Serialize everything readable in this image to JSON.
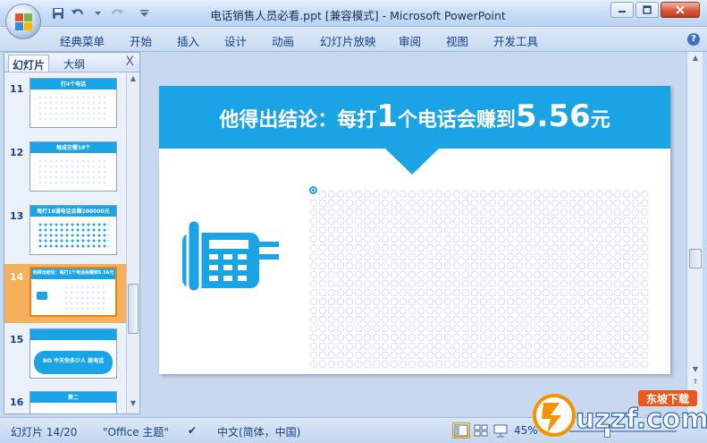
{
  "window": {
    "title": "电话销售人员必看.ppt [兼容模式] - Microsoft PowerPoint",
    "controls": [
      "minimize",
      "restore",
      "close"
    ]
  },
  "quick_access": [
    "save-icon",
    "undo-icon",
    "redo-icon",
    "customize-icon"
  ],
  "ribbon": {
    "tabs": [
      "经典菜单",
      "开始",
      "插入",
      "设计",
      "动画",
      "幻灯片放映",
      "审阅",
      "视图",
      "开发工具"
    ]
  },
  "left_pane": {
    "tabs": [
      "幻灯片",
      "大纲"
    ],
    "close_label": "X",
    "thumbnails": [
      {
        "number": "11",
        "caption": "打4个电话"
      },
      {
        "number": "12",
        "caption": "每成交需18个"
      },
      {
        "number": "13",
        "caption": "每打18通电话会赚200000元"
      },
      {
        "number": "14",
        "caption": "他得出结论：每打1个电话会赚到5.56元",
        "selected": true
      },
      {
        "number": "15",
        "caption": "NO 今天你多少人 拨电话"
      },
      {
        "number": "16",
        "caption": "第二"
      }
    ]
  },
  "slide": {
    "title_prefix": "他得出结论：每打",
    "title_num1": "1",
    "title_mid": "个电话会赚到",
    "title_num2": "5.56",
    "title_suffix": "元",
    "equals_sign": "=",
    "accent_color": "#1aa4e5"
  },
  "status": {
    "slide_info": "幻灯片 14/20",
    "theme": "\"Office 主题\"",
    "language": "中文(简体，中国)",
    "zoom": "45%"
  },
  "watermark": {
    "text": "uzzf.com",
    "badge": "东坡下载"
  }
}
